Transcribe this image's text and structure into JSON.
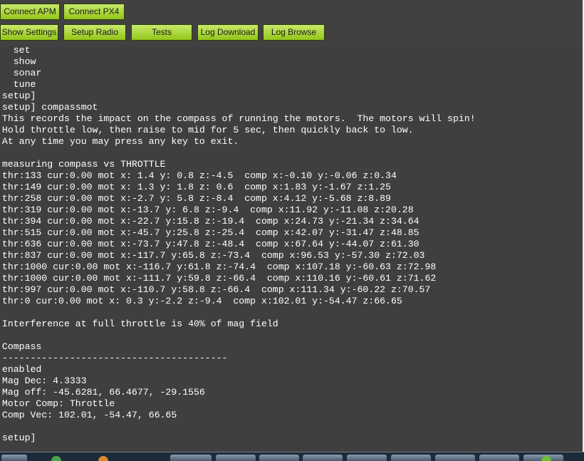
{
  "toolbar": {
    "connect_apm": "Connect APM",
    "connect_px4": "Connect PX4",
    "show_settings": "Show Settings",
    "setup_radio": "Setup Radio",
    "tests": "Tests",
    "log_download": "Log Download",
    "log_browse": "Log Browse"
  },
  "terminal": {
    "lines": [
      "   set",
      "   show",
      "   sonar",
      "   tune",
      " setup]",
      " setup] compassmot",
      " This records the impact on the compass of running the motors.  The motors will spin!",
      " Hold throttle low, then raise to mid for 5 sec, then quickly back to low.",
      " At any time you may press any key to exit.",
      "",
      " measuring compass vs THROTTLE",
      " thr:133 cur:0.00 mot x: 1.4 y: 0.8 z:-4.5  comp x:-0.10 y:-0.06 z:0.34",
      " thr:149 cur:0.00 mot x: 1.3 y: 1.8 z: 0.6  comp x:1.83 y:-1.67 z:1.25",
      " thr:258 cur:0.00 mot x:-2.7 y: 5.8 z:-8.4  comp x:4.12 y:-5.68 z:8.89",
      " thr:319 cur:0.00 mot x:-13.7 y: 6.8 z:-9.4  comp x:11.92 y:-11.08 z:20.28",
      " thr:394 cur:0.00 mot x:-22.7 y:15.8 z:-19.4  comp x:24.73 y:-21.34 z:34.64",
      " thr:515 cur:0.00 mot x:-45.7 y:25.8 z:-25.4  comp x:42.07 y:-31.47 z:48.85",
      " thr:636 cur:0.00 mot x:-73.7 y:47.8 z:-48.4  comp x:67.64 y:-44.07 z:61.30",
      " thr:837 cur:0.00 mot x:-117.7 y:65.8 z:-73.4  comp x:96.53 y:-57.30 z:72.03",
      " thr:1000 cur:0.00 mot x:-116.7 y:61.8 z:-74.4  comp x:107.18 y:-60.63 z:72.98",
      " thr:1000 cur:0.00 mot x:-111.7 y:59.8 z:-66.4  comp x:110.16 y:-60.61 z:71.62",
      " thr:997 cur:0.00 mot x:-110.7 y:58.8 z:-66.4  comp x:111.34 y:-60.22 z:70.57",
      " thr:0 cur:0.00 mot x: 0.3 y:-2.2 z:-9.4  comp x:102.01 y:-54.47 z:66.65",
      "",
      " Interference at full throttle is 40% of mag field",
      "",
      " Compass",
      " ----------------------------------------",
      " enabled",
      " Mag Dec: 4.3333",
      " Mag off: -45.6281, 66.4677, -29.1556",
      " Motor Comp: Throttle",
      " Comp Vec: 102.01, -54.47, 66.65",
      "",
      " setup]"
    ]
  },
  "colors": {
    "button_top": "#c6ea6a",
    "button_bottom": "#93c519",
    "terminal_bg": "#3f3f3f",
    "terminal_fg": "#ffffff"
  }
}
